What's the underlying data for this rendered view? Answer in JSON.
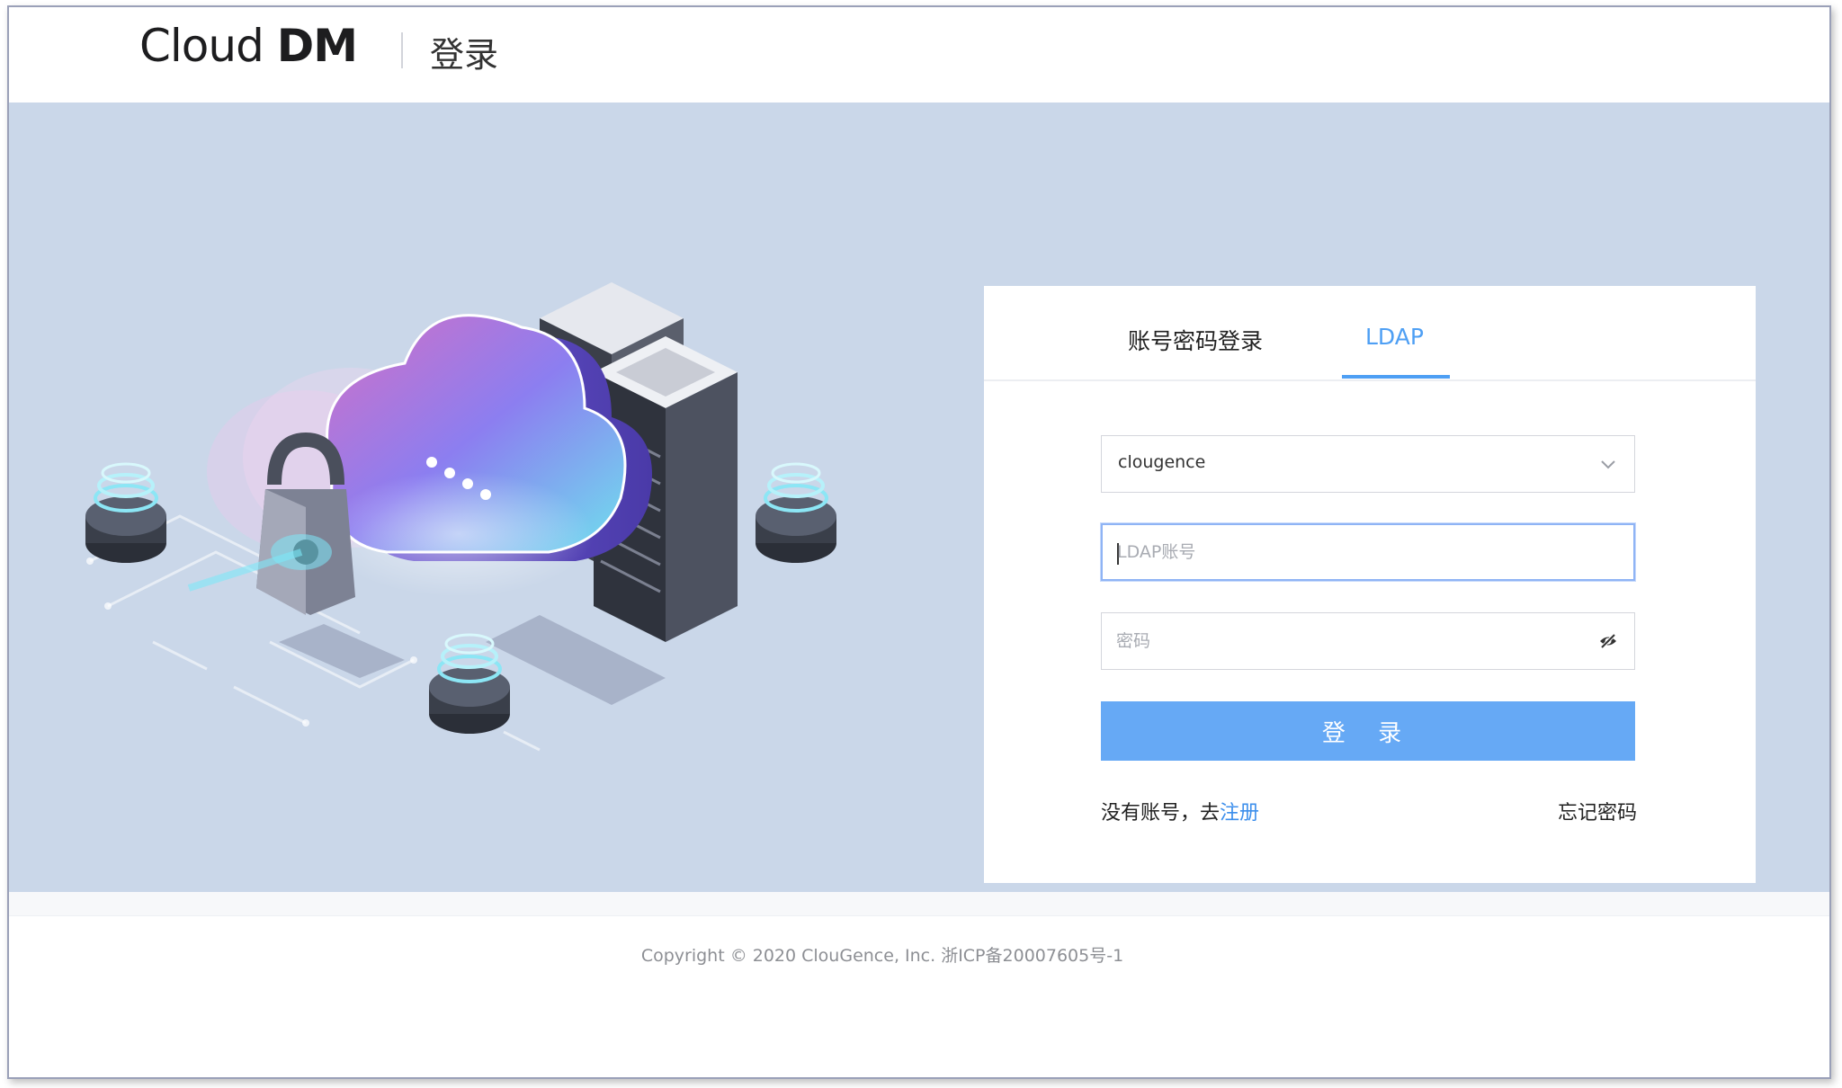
{
  "header": {
    "logo_text_cloud": "Cloud",
    "logo_text_dm": "DM",
    "page_title": "登录"
  },
  "login": {
    "tabs": [
      {
        "label": "账号密码登录",
        "active": false
      },
      {
        "label": "LDAP",
        "active": true
      }
    ],
    "domain_select": {
      "value": "clougence"
    },
    "account_field": {
      "placeholder": "LDAP账号",
      "value": ""
    },
    "password_field": {
      "placeholder": "密码",
      "value": ""
    },
    "submit_label": "登 录",
    "no_account_text": "没有账号，去",
    "register_link": "注册",
    "forgot_password": "忘记密码"
  },
  "footer": {
    "copyright": "Copyright © 2020 ClouGence, Inc.  浙ICP备20007605号-1"
  },
  "colors": {
    "accent": "#4e9ff4",
    "button": "#66a9f5",
    "hero_background": "#cad7e9"
  },
  "icons": {
    "select_arrow": "chevron-down-icon",
    "password_toggle": "eye-off-icon"
  }
}
